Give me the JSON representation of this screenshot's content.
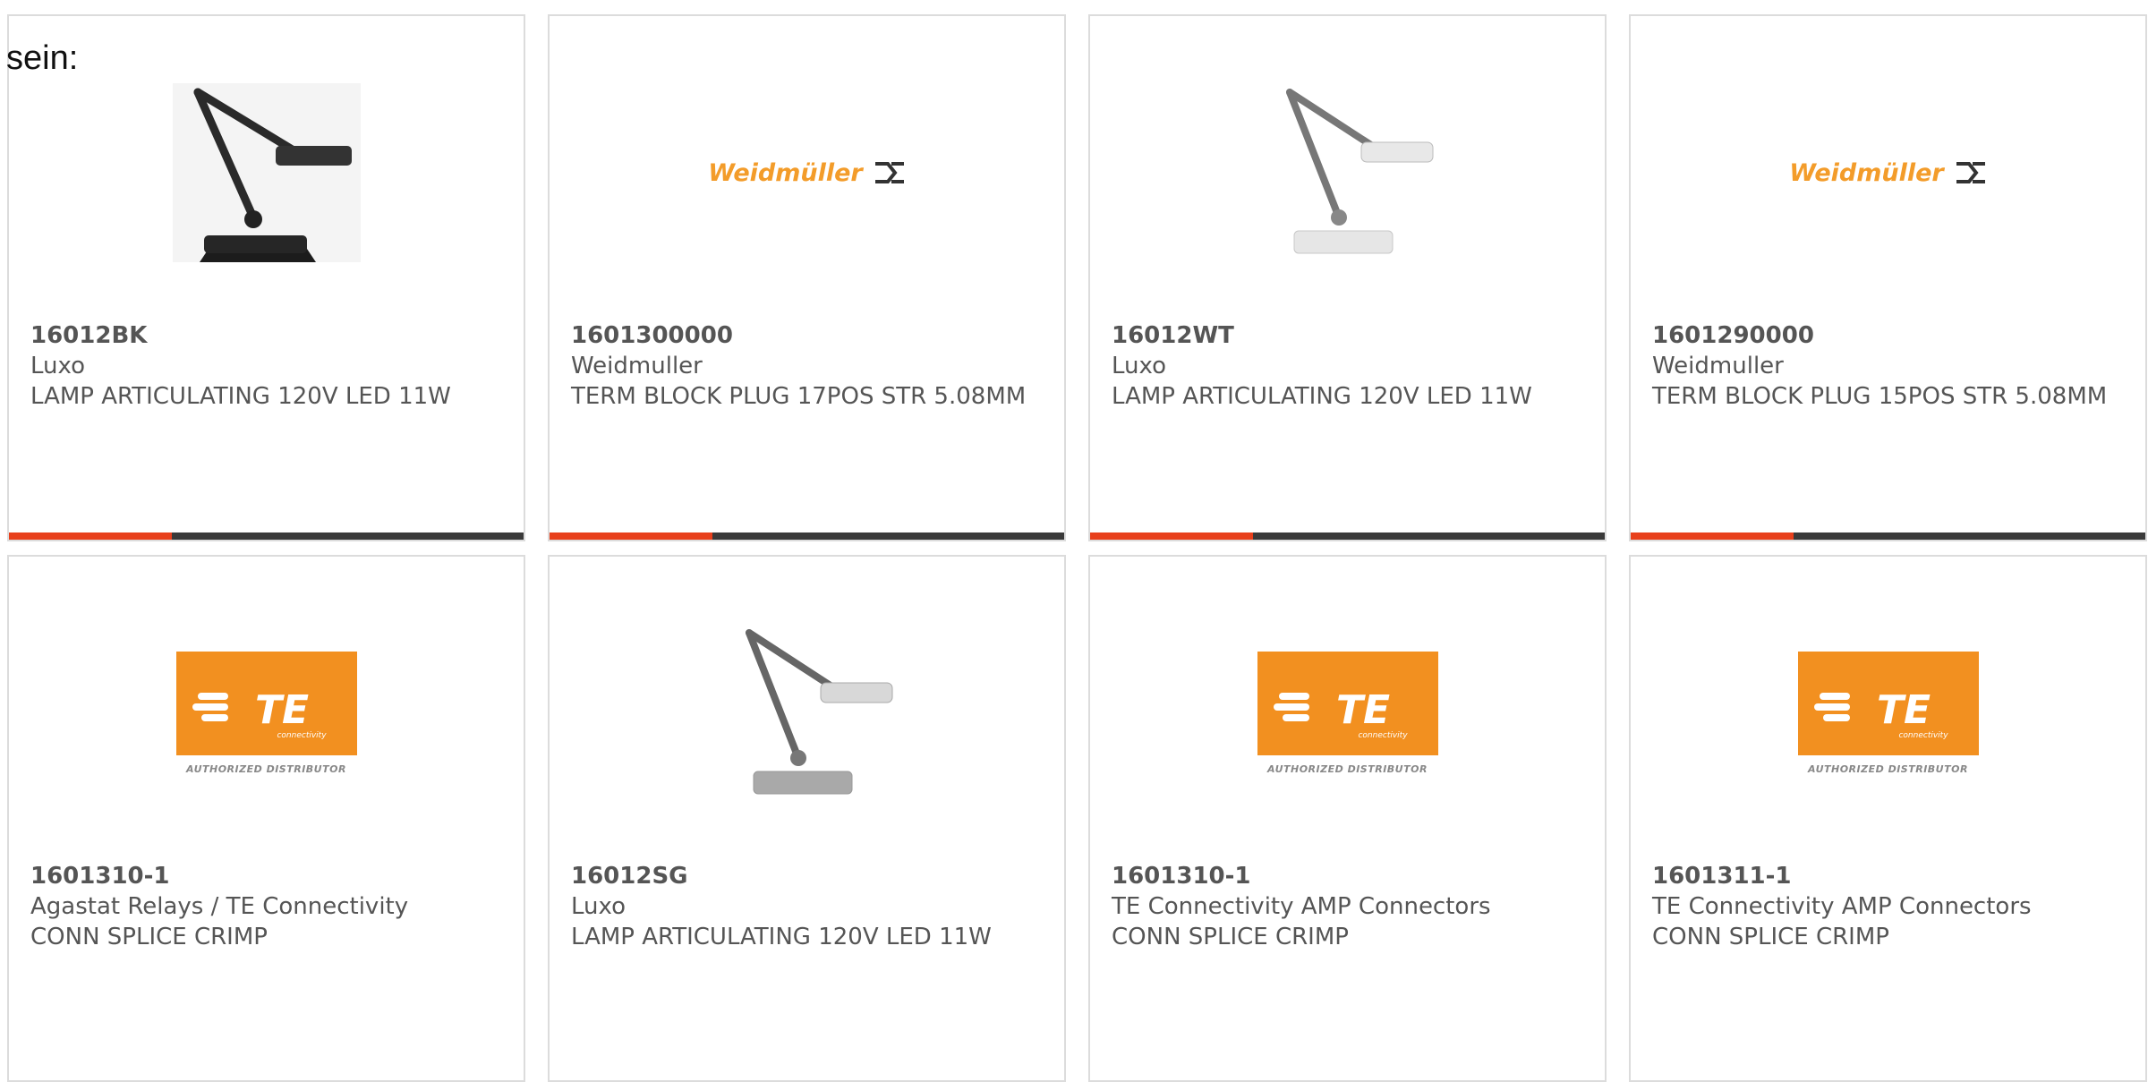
{
  "intro_text": "sein:",
  "cards": [
    {
      "part": "16012BK",
      "brand": "Luxo",
      "desc": "LAMP ARTICULATING 120V LED 11W",
      "image": "lamp-black-icon"
    },
    {
      "part": "1601300000",
      "brand": "Weidmuller",
      "desc": "TERM BLOCK PLUG 17POS STR 5.08MM",
      "image": "weidmuller-logo",
      "logo_text": "Weidmüller"
    },
    {
      "part": "16012WT",
      "brand": "Luxo",
      "desc": "LAMP ARTICULATING 120V LED 11W",
      "image": "lamp-white-icon"
    },
    {
      "part": "1601290000",
      "brand": "Weidmuller",
      "desc": "TERM BLOCK PLUG 15POS STR 5.08MM",
      "image": "weidmuller-logo",
      "logo_text": "Weidmüller"
    },
    {
      "part": "1601310-1",
      "brand": "Agastat Relays / TE Connectivity",
      "desc": "CONN SPLICE CRIMP",
      "image": "te-logo",
      "logo_text": "TE",
      "logo_sub": "connectivity",
      "logo_caption": "AUTHORIZED DISTRIBUTOR"
    },
    {
      "part": "16012SG",
      "brand": "Luxo",
      "desc": "LAMP ARTICULATING 120V LED 11W",
      "image": "lamp-grey-icon"
    },
    {
      "part": "1601310-1",
      "brand": "TE Connectivity AMP Connectors",
      "desc": "CONN SPLICE CRIMP",
      "image": "te-logo",
      "logo_text": "TE",
      "logo_sub": "connectivity",
      "logo_caption": "AUTHORIZED DISTRIBUTOR"
    },
    {
      "part": "1601311-1",
      "brand": "TE Connectivity AMP Connectors",
      "desc": "CONN SPLICE CRIMP",
      "image": "te-logo",
      "logo_text": "TE",
      "logo_sub": "connectivity",
      "logo_caption": "AUTHORIZED DISTRIBUTOR"
    }
  ],
  "colors": {
    "accent": "#e8401c",
    "bar": "#3a3a3a",
    "te_orange": "#f29020",
    "weidmuller_orange": "#f39c2a"
  }
}
